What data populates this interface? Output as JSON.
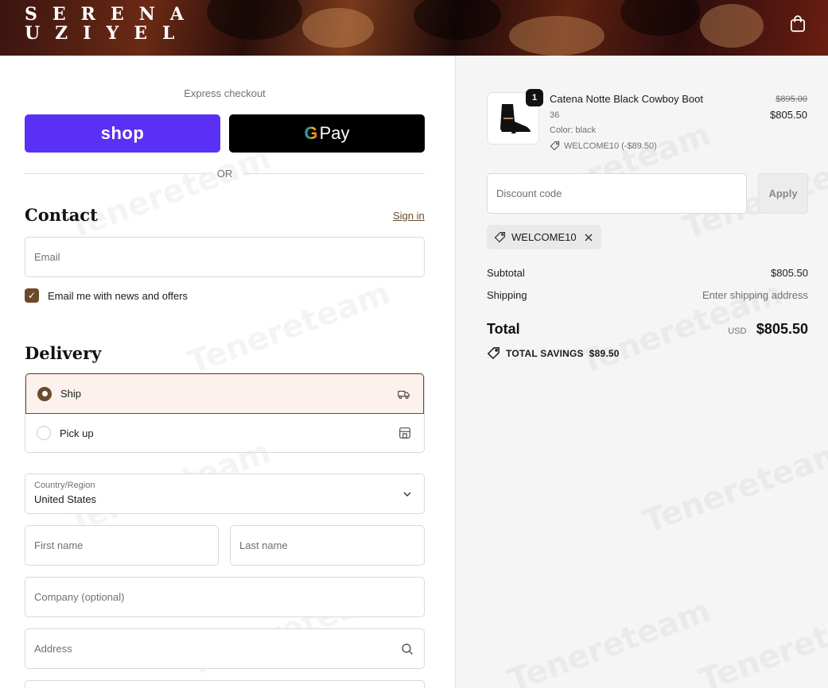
{
  "header": {
    "logo_line1": "SERENA",
    "logo_line2": "UZIYEL",
    "cart_icon": "shopping-bag-icon"
  },
  "express": {
    "label": "Express checkout",
    "shop_pay": "shop",
    "gpay": "Pay",
    "gpay_g": "G",
    "or": "OR"
  },
  "contact": {
    "title": "Contact",
    "signin": "Sign in",
    "email_placeholder": "Email",
    "newsletter_label": "Email me with news and offers",
    "newsletter_checked": true
  },
  "delivery": {
    "title": "Delivery",
    "options": [
      {
        "label": "Ship",
        "selected": true,
        "icon": "truck-icon"
      },
      {
        "label": "Pick up",
        "selected": false,
        "icon": "store-icon"
      }
    ],
    "country_label": "Country/Region",
    "country_value": "United States",
    "first_name": "First name",
    "last_name": "Last name",
    "company": "Company (optional)",
    "address": "Address"
  },
  "summary": {
    "product": {
      "name": "Catena Notte Black Cowboy Boot",
      "quantity": "1",
      "size": "36",
      "color": "Color: black",
      "discount": "WELCOME10 (-$89.50)",
      "original_price": "$895.00",
      "price": "$805.50"
    },
    "discount_placeholder": "Discount code",
    "apply_label": "Apply",
    "applied_code": "WELCOME10",
    "subtotal_label": "Subtotal",
    "subtotal_value": "$805.50",
    "shipping_label": "Shipping",
    "shipping_value": "Enter shipping address",
    "total_label": "Total",
    "currency": "USD",
    "total_value": "$805.50",
    "savings_label": "TOTAL SAVINGS",
    "savings_value": "$89.50"
  },
  "watermark": "Tenereteam",
  "colors": {
    "accent": "#6b4a2b",
    "shop_pay": "#5a31f4",
    "selected_bg": "#fcf1ec"
  }
}
